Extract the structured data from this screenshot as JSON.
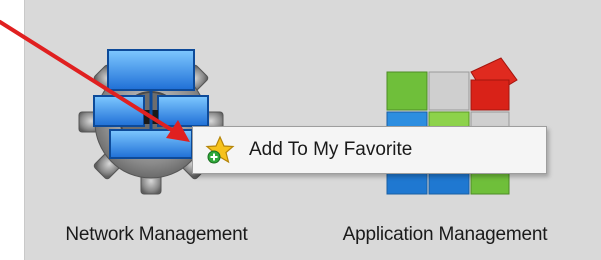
{
  "apps": [
    {
      "label": "Network Management",
      "icon": "network-gear-icon"
    },
    {
      "label": "Application Management",
      "icon": "application-blocks-icon"
    }
  ],
  "context_menu": {
    "items": [
      {
        "label": "Add To My Favorite",
        "icon": "star-add-icon"
      }
    ]
  },
  "annotation": {
    "type": "arrow",
    "color": "#e02020"
  },
  "colors": {
    "panel_bg": "#d9d9d9",
    "menu_bg": "#f5f5f5",
    "text": "#1a1a1a"
  }
}
